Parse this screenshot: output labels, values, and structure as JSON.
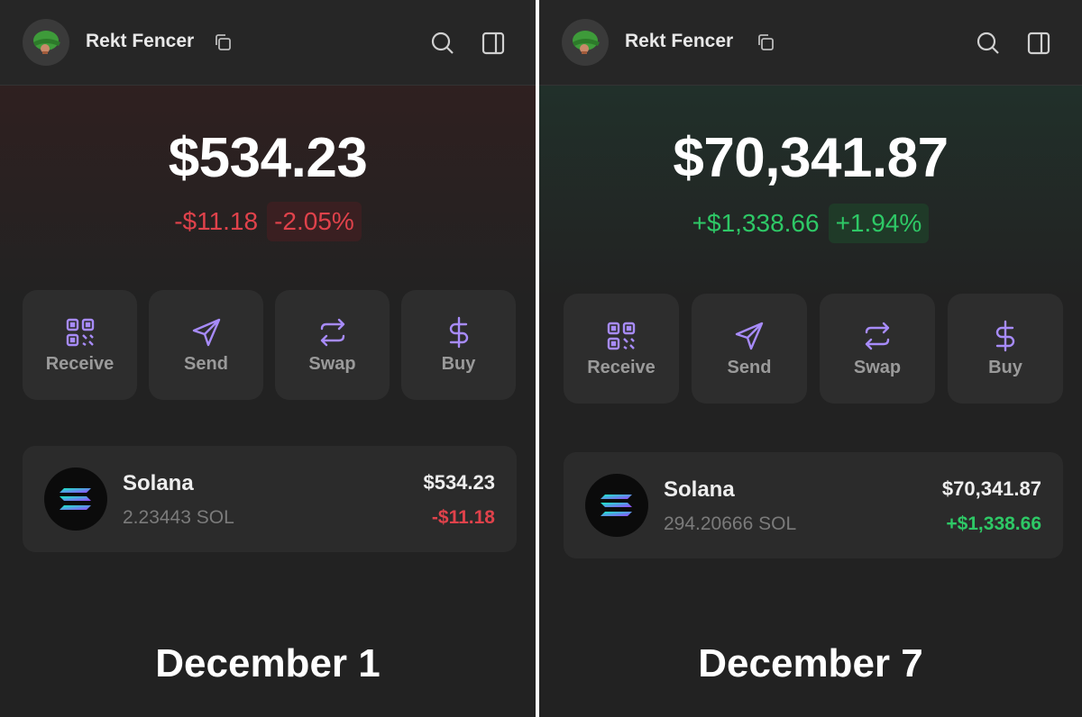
{
  "colors": {
    "background": "#222222",
    "card": "#2d2d2d",
    "accent_purple": "#a78bfa",
    "negative": "#e0424b",
    "positive": "#2ec866"
  },
  "panels": [
    {
      "wallet_name": "Rekt Fencer",
      "balance": "$534.23",
      "change_abs": "-$11.18",
      "change_pct": "-2.05%",
      "trend": "negative",
      "actions": [
        {
          "label": "Receive",
          "icon": "qr-code-icon"
        },
        {
          "label": "Send",
          "icon": "send-icon"
        },
        {
          "label": "Swap",
          "icon": "swap-icon"
        },
        {
          "label": "Buy",
          "icon": "dollar-icon"
        }
      ],
      "token": {
        "name": "Solana",
        "amount": "2.23443 SOL",
        "value": "$534.23",
        "change": "-$11.18"
      },
      "caption": "December 1"
    },
    {
      "wallet_name": "Rekt Fencer",
      "balance": "$70,341.87",
      "change_abs": "+$1,338.66",
      "change_pct": "+1.94%",
      "trend": "positive",
      "actions": [
        {
          "label": "Receive",
          "icon": "qr-code-icon"
        },
        {
          "label": "Send",
          "icon": "send-icon"
        },
        {
          "label": "Swap",
          "icon": "swap-icon"
        },
        {
          "label": "Buy",
          "icon": "dollar-icon"
        }
      ],
      "token": {
        "name": "Solana",
        "amount": "294.20666 SOL",
        "value": "$70,341.87",
        "change": "+$1,338.66"
      },
      "caption": "December 7"
    }
  ]
}
